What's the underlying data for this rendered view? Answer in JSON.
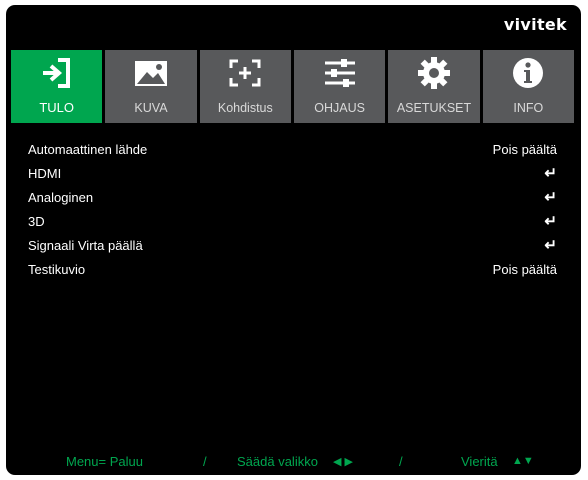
{
  "brand": "vivitek",
  "tabs": [
    {
      "label": "TULO",
      "icon": "input-icon",
      "active": true
    },
    {
      "label": "KUVA",
      "icon": "image-icon",
      "active": false
    },
    {
      "label": "Kohdistus",
      "icon": "focus-icon",
      "active": false
    },
    {
      "label": "OHJAUS",
      "icon": "sliders-icon",
      "active": false
    },
    {
      "label": "ASETUKSET",
      "icon": "gear-icon",
      "active": false
    },
    {
      "label": "INFO",
      "icon": "info-icon",
      "active": false
    }
  ],
  "rows": [
    {
      "label": "Automaattinen lähde",
      "value": "Pois päältä"
    },
    {
      "label": "HDMI",
      "value": "↵"
    },
    {
      "label": "Analoginen",
      "value": "↵"
    },
    {
      "label": "3D",
      "value": "↵"
    },
    {
      "label": "Signaali Virta päällä",
      "value": "↵"
    },
    {
      "label": "Testikuvio",
      "value": "Pois päältä"
    }
  ],
  "footer": {
    "menu": "Menu= Paluu",
    "sep1": "/",
    "adjust": "Säädä valikko",
    "adjust_arrows": "◀ ▶",
    "sep2": "/",
    "scroll": "Vieritä",
    "scroll_arrows": "▲▼"
  },
  "colors": {
    "accent": "#00a64f",
    "tab_bg": "#58595b",
    "background": "#000000"
  }
}
